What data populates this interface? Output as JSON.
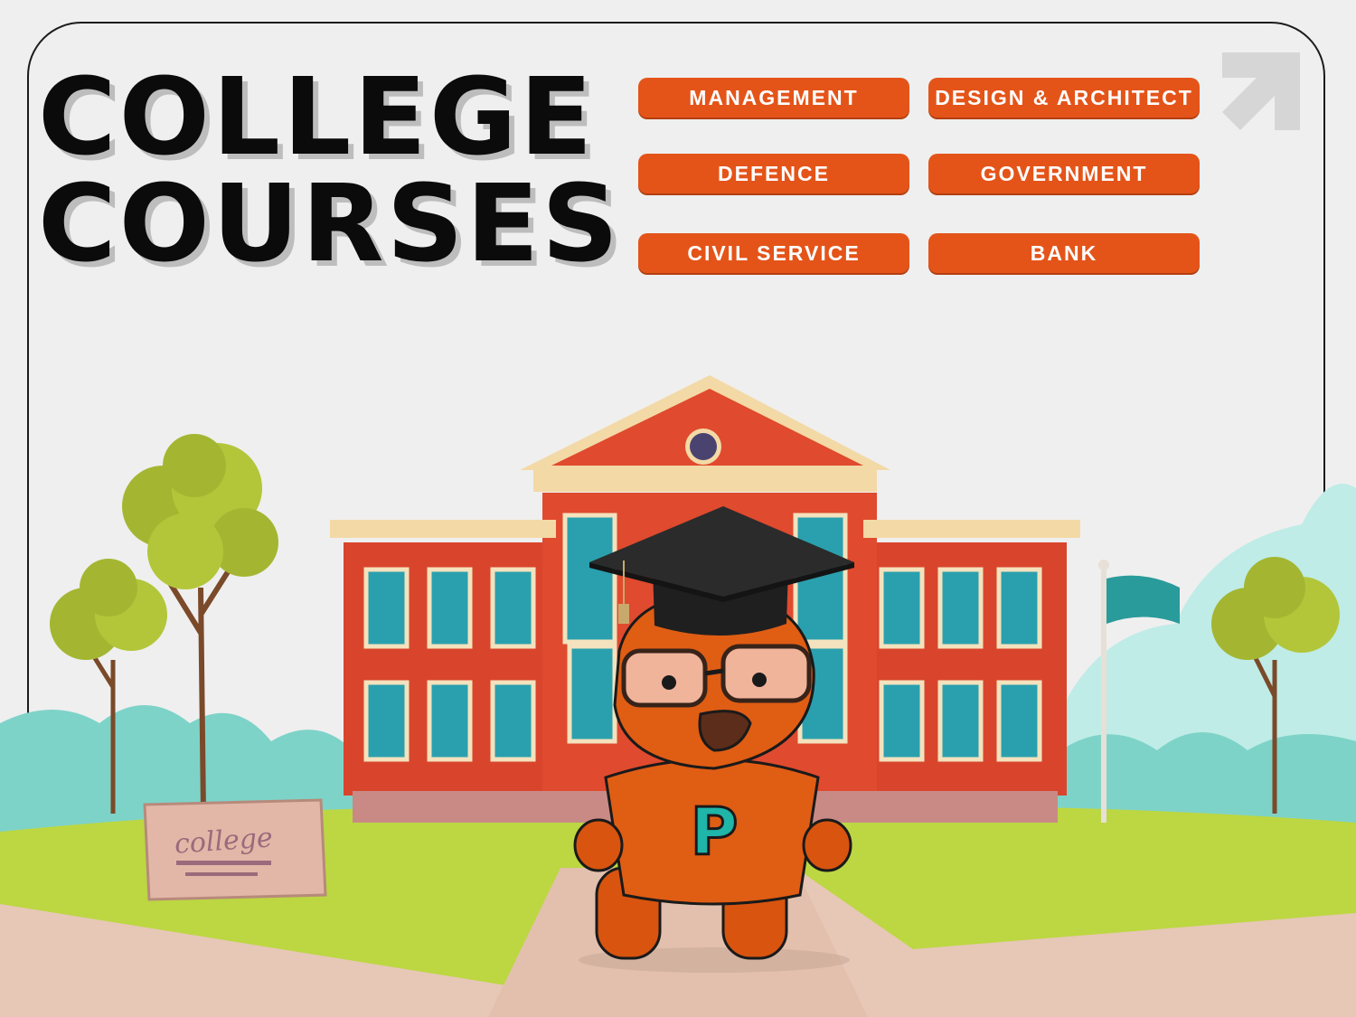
{
  "title": {
    "line1": "COLLEGE",
    "line2": "COURSES"
  },
  "courses": [
    "MANAGEMENT",
    "DESIGN & ARCHITECT",
    "DEFENCE",
    "GOVERNMENT",
    "CIVIL SERVICE",
    "BANK"
  ],
  "sign_text": "college",
  "mascot_letter": "P",
  "colors": {
    "accent": "#e45419",
    "text": "#0b0b0b",
    "brick": "#d9452c",
    "grass": "#b9d53a",
    "teal": "#2aa39b"
  }
}
